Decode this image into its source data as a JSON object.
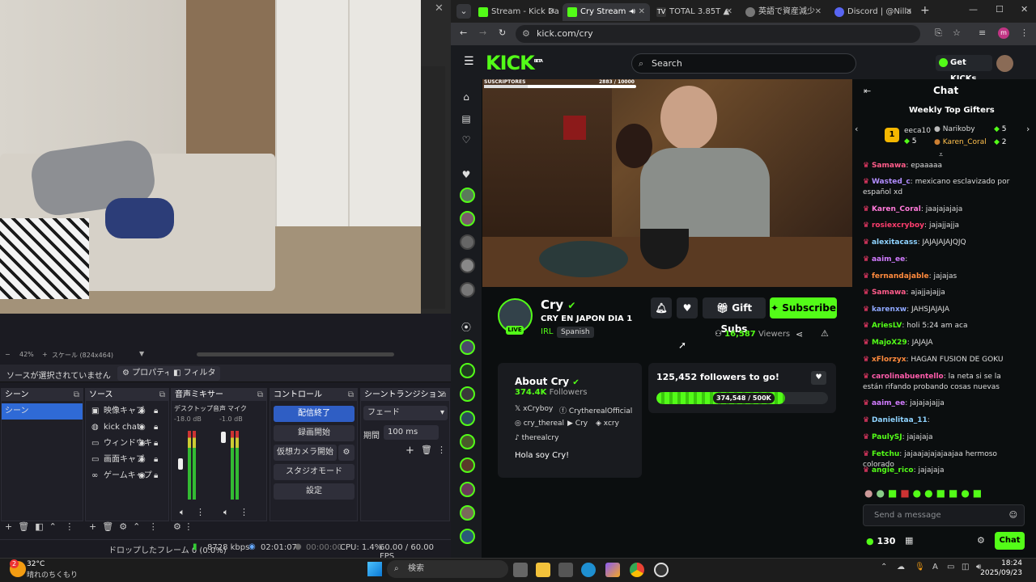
{
  "obs": {
    "zoom": "42%",
    "scale": "スケール (824x464)",
    "no_source": "ソースが選択されていません",
    "properties": "プロパティ",
    "filters": "フィルタ",
    "docks": {
      "scenes": {
        "title": "シーン",
        "items": [
          "シーン"
        ]
      },
      "sources": {
        "title": "ソース",
        "items": [
          "映像キャプ",
          "kick chat",
          "ウィンドウキ",
          "画面キャプ",
          "ゲームキャプ"
        ]
      },
      "mixer": {
        "title": "音声ミキサー",
        "ch1": "デスクトップ音声",
        "ch1_db": "-18.0 dB",
        "ch2": "マイク",
        "ch2_db": "-1.0 dB",
        "scale": [
          "0",
          "-5",
          "-10",
          "-15",
          "-20",
          "-25",
          "-30",
          "-35",
          "-40",
          "-45",
          "-50",
          "-55",
          "-60"
        ]
      },
      "controls": {
        "title": "コントロール",
        "stop": "配信終了",
        "record": "録画開始",
        "vcam": "仮想カメラ開始",
        "studio": "スタジオモード",
        "settings": "設定"
      },
      "transitions": {
        "title": "シーントランジション",
        "type": "フェード",
        "duration_label": "期間",
        "duration": "100 ms"
      }
    },
    "status": {
      "dropped": "ドロップしたフレーム 0 (0.0%)",
      "kbps": "8728 kbps",
      "live": "02:01:07",
      "rec": "00:00:00",
      "cpu": "CPU: 1.4%",
      "fps": "60.00 / 60.00 FPS"
    }
  },
  "browser": {
    "tabs": [
      {
        "label": "Stream - Kick Da",
        "color": "#53fc18"
      },
      {
        "label": "Cry Stream - ",
        "color": "#53fc18"
      },
      {
        "label": "TOTAL 3.85T ▲",
        "color": "#ffffff"
      },
      {
        "label": "英語で資産減少",
        "color": "#999999"
      },
      {
        "label": "Discord | @Nilla",
        "color": "#5865f2"
      }
    ],
    "url": "kick.com/cry"
  },
  "kick": {
    "logo": "KICK",
    "beta": "BETA",
    "search": "Search",
    "get_kicks": "Get KICKs",
    "subs_label": "SUSCRIPTORES",
    "subs_count": "2883 / 10000",
    "streamer": "Cry",
    "title": "CRY EN JAPON DIA 1",
    "category": "IRL",
    "language": "Spanish",
    "live": "LIVE",
    "gift_subs": "Gift Subs",
    "subscribe": "Subscribe",
    "viewers": "16,587",
    "viewers_label": "Viewers",
    "about": {
      "title": "About Cry",
      "followers": "374.4K",
      "followers_label": "Followers",
      "links": [
        "xCryboy",
        "CrytherealOfficial",
        "cry_thereal",
        "Cry",
        "xcry",
        "therealcry"
      ],
      "bio": "Hola soy Cry!"
    },
    "goal": {
      "title": "125,452 followers to go!",
      "progress": "374,548 / 500K",
      "fraction": 0.749
    }
  },
  "chat": {
    "title": "Chat",
    "gifters_title": "Weekly Top Gifters",
    "gifters": [
      {
        "rank": "1",
        "name": "eeca10",
        "count": "5"
      },
      {
        "name": "Narikoby",
        "count": "5"
      },
      {
        "name": "Karen_Coral",
        "count": "2"
      }
    ],
    "messages": [
      {
        "user": "Samawa",
        "color": "#ff5c8a",
        "text": ": epaaaaa"
      },
      {
        "user": "Wasted_c",
        "color": "#b28dff",
        "text": ": mexicano esclavizado por español xd"
      },
      {
        "user": "Karen_Coral",
        "color": "#ff7ad9",
        "text": ": jaajajajaja"
      },
      {
        "user": "rosiexcryboy",
        "color": "#ff3d6e",
        "text": ": jajajjajja"
      },
      {
        "user": "alexitacass",
        "color": "#8fd3ff",
        "text": ": JAJAJAJAJQJQ"
      },
      {
        "user": "aaim_ee",
        "color": "#d17bff",
        "text": ":"
      },
      {
        "user": "fernandajable",
        "color": "#ff8a3d",
        "text": ": jajajas"
      },
      {
        "user": "Samawa",
        "color": "#ff5c8a",
        "text": ": ajajjajajja"
      },
      {
        "user": "karenxw",
        "color": "#8fa8ff",
        "text": ": JAHSJAJAJA"
      },
      {
        "user": "AriesLV",
        "color": "#53fc18",
        "text": ": holi 5:24 am aca"
      },
      {
        "user": "MajoX29",
        "color": "#53fc18",
        "text": ": JAJAJA"
      },
      {
        "user": "xFlorzyx",
        "color": "#ff8a3d",
        "text": ": HAGAN FUSION DE GOKU"
      },
      {
        "user": "carolinabuentello",
        "color": "#ff5cab",
        "text": ": la neta si se la están rifando probando cosas nuevas"
      },
      {
        "user": "aaim_ee",
        "color": "#d17bff",
        "text": ": jajajajajja"
      },
      {
        "user": "Danielitaa_11",
        "color": "#8fd3ff",
        "text": ":"
      },
      {
        "user": "PaulySJ",
        "color": "#53fc18",
        "text": ": jajajaja"
      },
      {
        "user": "Fetchu",
        "color": "#53fc18",
        "text": ": jajaajajajajaajaa hermoso colorado"
      },
      {
        "user": "angie_rico",
        "color": "#53fc18",
        "text": ": jajajaja"
      }
    ],
    "placeholder": "Send a message",
    "kicks": "130",
    "send": "Chat"
  },
  "taskbar": {
    "weather_temp": "32°C",
    "weather_desc": "晴れのちくもり",
    "search": "検索",
    "time": "18:24",
    "date": "2025/09/23",
    "badge": "2"
  }
}
